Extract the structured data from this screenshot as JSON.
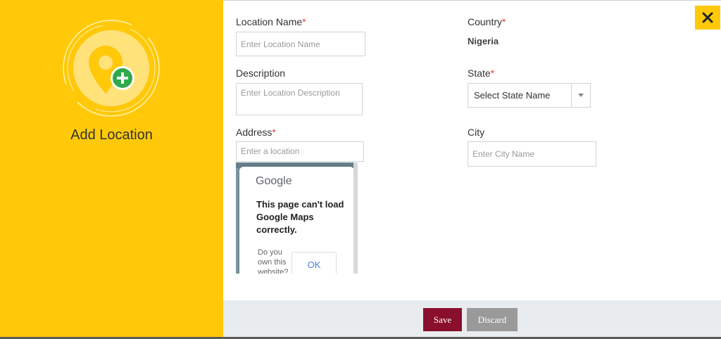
{
  "panel": {
    "title": "Add Location",
    "icon": "map-pin-add-icon",
    "accent_color": "#ffc90a"
  },
  "form": {
    "location_name": {
      "label": "Location Name",
      "required": "*",
      "placeholder": "Enter Location Name",
      "value": ""
    },
    "country": {
      "label": "Country",
      "required": "*",
      "value": "Nigeria"
    },
    "description": {
      "label": "Description",
      "placeholder": "Enter Location Description",
      "value": ""
    },
    "state": {
      "label": "State",
      "required": "*",
      "selected": "Select State Name"
    },
    "address": {
      "label": "Address",
      "required": "*",
      "placeholder": "Enter a location",
      "value": ""
    },
    "city": {
      "label": "City",
      "placeholder": "Enter City Name",
      "value": ""
    }
  },
  "map": {
    "logo": "Google",
    "message": "This page can't load Google Maps correctly.",
    "own_site": "Do you own this website?",
    "ok_label": "OK"
  },
  "footer": {
    "save_label": "Save",
    "discard_label": "Discard",
    "save_color": "#8a0f2c",
    "discard_color": "#9a9a9a"
  },
  "close_icon": "close-icon"
}
